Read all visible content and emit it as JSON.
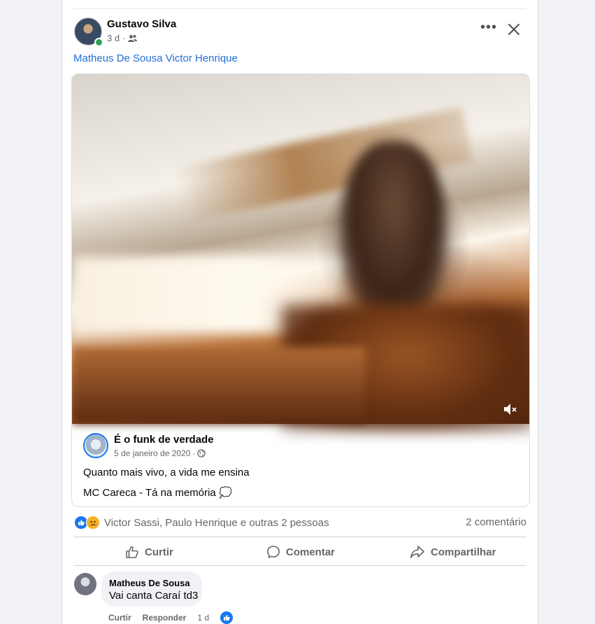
{
  "post": {
    "author": "Gustavo Silva",
    "time": "3 d",
    "audience_icon": "friends-icon",
    "tags": [
      "Matheus De Sousa",
      "Victor Henrique"
    ]
  },
  "shared": {
    "page_name": "É o funk de verdade",
    "date": "5 de janeiro de 2020",
    "privacy_icon": "globe-icon",
    "text_line1": "Quanto mais vivo, a vida me ensina",
    "text_line2": "MC Careca - Tá na memória 💭",
    "video_muted_icon": "speaker-muted-icon"
  },
  "stats": {
    "reaction_names": "Victor Sassi, Paulo Henrique e outras 2 pessoas",
    "comment_count": "2 comentário"
  },
  "actions": {
    "like": "Curtir",
    "comment": "Comentar",
    "share": "Compartilhar"
  },
  "comment": {
    "author": "Matheus De Sousa",
    "text": "Vai canta Caraí td3",
    "like_label": "Curtir",
    "reply_label": "Responder",
    "time": "1 d"
  },
  "colors": {
    "accent": "#1877f2",
    "link": "#216fdb",
    "secondary_text": "#65676b",
    "background": "#f0f2f5"
  }
}
